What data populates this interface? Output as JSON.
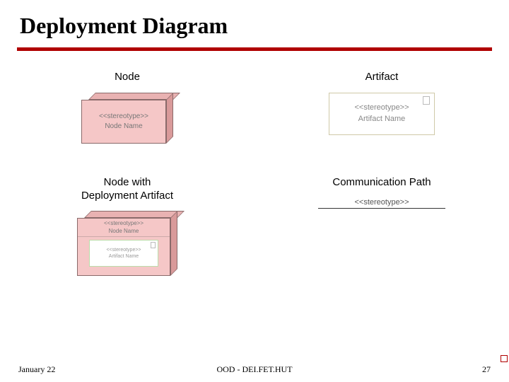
{
  "title": "Deployment Diagram",
  "grid": {
    "r1c1": {
      "label": "Node",
      "stereotype": "<<stereotype>>",
      "name": "Node Name"
    },
    "r1c2": {
      "label": "Artifact",
      "stereotype": "<<stereotype>>",
      "name": "Artifact Name"
    },
    "r2c1": {
      "label": "Node with\nDeployment Artifact",
      "outer_stereotype": "<<stereotype>>",
      "outer_name": "Node Name",
      "inner_stereotype": "<<stereotype>>",
      "inner_name": "Artifact Name"
    },
    "r2c2": {
      "label": "Communication Path",
      "stereotype": "<<stereotype>>"
    }
  },
  "footer": {
    "date": "January 22",
    "center": "OOD - DEI.FET.HUT",
    "page": "27"
  }
}
